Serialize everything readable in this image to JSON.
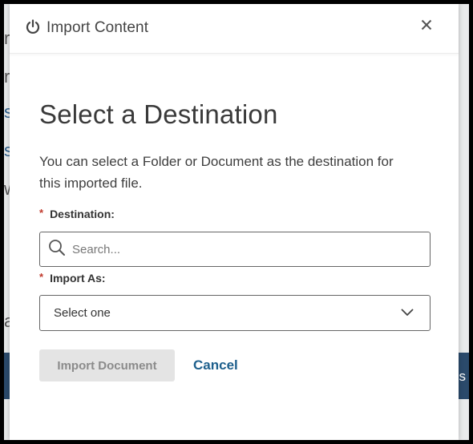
{
  "modal": {
    "title": "Import Content",
    "heading": "Select a Destination",
    "description": "You can select a Folder or Document as the destination for this imported file.",
    "destination": {
      "required_mark": "*",
      "label": "Destination:",
      "placeholder": "Search..."
    },
    "import_as": {
      "required_mark": "*",
      "label": "Import As:",
      "selected": "Select one"
    },
    "actions": {
      "import_label": "Import Document",
      "cancel_label": "Cancel"
    }
  },
  "background": {
    "fragments": [
      "r",
      "r",
      "s",
      "s",
      "w",
      "a"
    ],
    "band_text": "s"
  },
  "icons": {
    "title_icon": "power-icon",
    "close": "close-icon",
    "search": "search-icon",
    "dropdown": "chevron-down-icon"
  },
  "colors": {
    "link": "#1d5f8c",
    "required": "#c0392b",
    "disabled_button_bg": "#e4e4e4",
    "disabled_button_text": "#8b8b8b"
  }
}
